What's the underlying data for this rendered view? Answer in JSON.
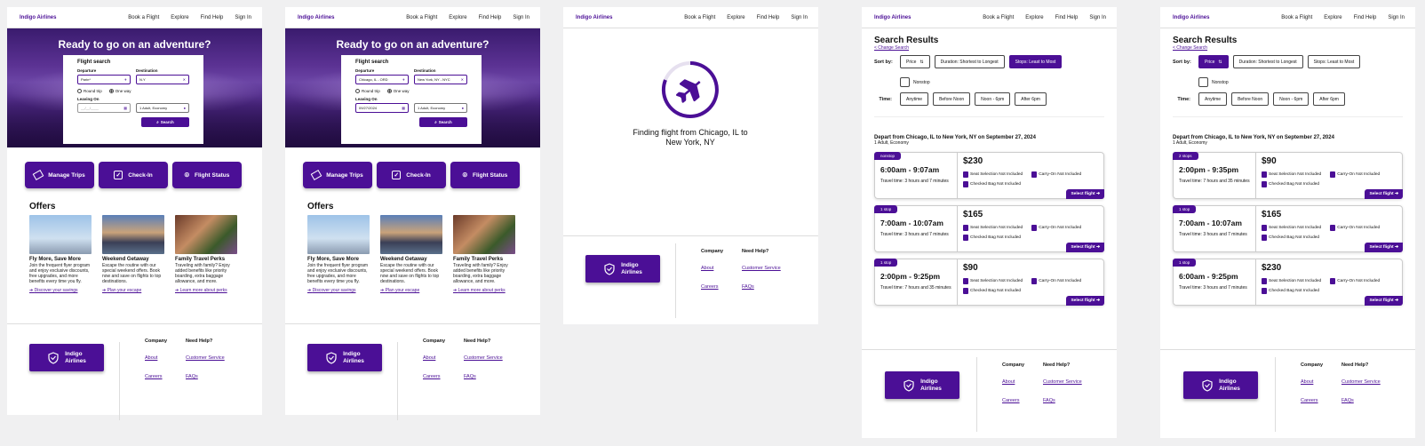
{
  "brand": "Indigo Airlines",
  "nav": [
    "Book a Flight",
    "Explore",
    "Find Help",
    "Sign In"
  ],
  "hero": {
    "title": "Ready to go on an adventure?"
  },
  "search": {
    "title": "Flight search",
    "departure_label": "Departure",
    "destination_label": "Destination",
    "round_trip": "Round trip",
    "one_way": "One way",
    "leaving_label": "Leaving On",
    "passengers": "1 Adult, Economy",
    "button": "Search",
    "s1": {
      "departure": "Parin*",
      "destination": "N.Y",
      "date": "__/__/____"
    },
    "s2": {
      "departure": "Chicago, IL - ORD",
      "destination": "New York, NY - NYC",
      "date": "09/27/2024"
    }
  },
  "actions": [
    "Manage Trips",
    "Check-In",
    "Flight Status"
  ],
  "offers": {
    "title": "Offers",
    "items": [
      {
        "name": "Fly More, Save More",
        "text": "Join the frequent flyer program and enjoy exclusive discounts, free upgrades, and more benefits every time you fly.",
        "link": "Discover your savings"
      },
      {
        "name": "Weekend Getaway",
        "text": "Escape the routine with our special weekend offers. Book now and save on flights to top destinations.",
        "link": "Plan your escape"
      },
      {
        "name": "Family Travel Perks",
        "text": "Traveling with family? Enjoy added benefits like priority boarding, extra baggage allowance, and more.",
        "link": "Learn more about perks"
      }
    ]
  },
  "footer": {
    "logo_line1": "Indigo",
    "logo_line2": "Airlines",
    "company": "Company",
    "help": "Need Help?",
    "about": "About",
    "careers": "Careers",
    "service": "Customer Service",
    "faqs": "FAQs"
  },
  "loading": {
    "text": "Finding flight from Chicago, IL to New York, NY"
  },
  "results": {
    "title": "Search Results",
    "change": "< Change Search",
    "sort_label": "Sort by:",
    "sort": [
      "Price",
      "Duration: Shortest to Longest",
      "Stops: Least to Most"
    ],
    "nonstop": "Nonstop",
    "time_label": "Time:",
    "times": [
      "Anytime",
      "Before Noon",
      "Noon - 6pm",
      "After 6pm"
    ],
    "depart": "Depart from Chicago, IL to New York, NY on September 27, 2024",
    "pax": "1 Adult, Economy",
    "seat": "Seat Selection Not Included",
    "carry": "Carry-On Not Included",
    "bag": "Checked Bag Not Included",
    "select": "Select flight",
    "listA": [
      {
        "badge": "nonstop",
        "times": "6:00am - 9:07am",
        "travel": "Travel time: 3 hours and 7 minutes",
        "price": "$230"
      },
      {
        "badge": "1 stop",
        "times": "7:00am - 10:07am",
        "travel": "Travel time: 3 hours and 7 minutes",
        "price": "$165"
      },
      {
        "badge": "1 stop",
        "times": "2:00pm - 9:25pm",
        "travel": "Travel time: 7 hours and 35 minutes",
        "price": "$90"
      }
    ],
    "listB": [
      {
        "badge": "2 stops",
        "times": "2:00pm - 9:35pm",
        "travel": "Travel time: 7 hours and 35 minutes",
        "price": "$90"
      },
      {
        "badge": "1 stop",
        "times": "7:00am - 10:07am",
        "travel": "Travel time: 3 hours and 7 minutes",
        "price": "$165"
      },
      {
        "badge": "1 stop",
        "times": "6:00am - 9:25pm",
        "travel": "Travel time: 3 hours and 7 minutes",
        "price": "$230"
      }
    ]
  }
}
